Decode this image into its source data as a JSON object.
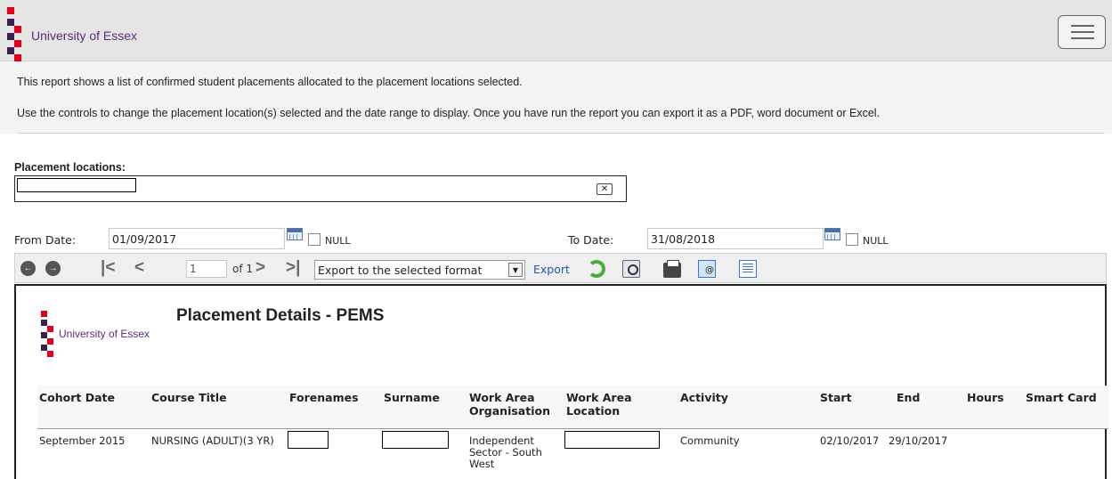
{
  "header": {
    "logo_text": "University of Essex",
    "menu_icon": "hamburger-icon",
    "brand_colors": {
      "purple": "#5a2d7a",
      "red": "#e3001b",
      "dark": "#3b1f4d"
    }
  },
  "intro": {
    "line1": "This report shows a list of confirmed student placements allocated to the placement locations selected.",
    "line2": "Use the controls to change the placement location(s) selected and the date range to display. Once you have run the report you can export it as a PDF, word document or Excel."
  },
  "filters": {
    "placement_locations_label": "Placement locations:",
    "from_date_label": "From Date:",
    "from_date_value": "01/09/2017",
    "to_date_label": "To Date:",
    "to_date_value": "31/08/2018",
    "null_label": "NULL"
  },
  "toolbar": {
    "page_value": "1",
    "of_pages": "of 1",
    "export_format": "Export to the selected format",
    "export_label": "Export",
    "first_glyph": "|<",
    "prev_glyph": "<",
    "next_glyph": ">",
    "last_glyph": ">|",
    "back_glyph": "←",
    "forward_glyph": "→"
  },
  "report": {
    "logo_text": "University of Essex",
    "title": "Placement Details - PEMS",
    "columns": [
      "Cohort Date",
      "Course Title",
      "Forenames",
      "Surname",
      "Work Area Organisation",
      "Work Area Location",
      "Activity",
      "Start",
      "End",
      "Hours",
      "Smart Card"
    ],
    "col_lines": {
      "org_1": "Work Area",
      "org_2": "Organisation",
      "loc_1": "Work Area",
      "loc_2": "Location"
    },
    "row": {
      "cohort": "September 2015",
      "course": "NURSING (ADULT)(3 YR)",
      "org_1": "Independent",
      "org_2": "Sector - South",
      "org_3": "West",
      "activity": "Community",
      "start": "02/10/2017",
      "end": "29/10/2017"
    }
  }
}
